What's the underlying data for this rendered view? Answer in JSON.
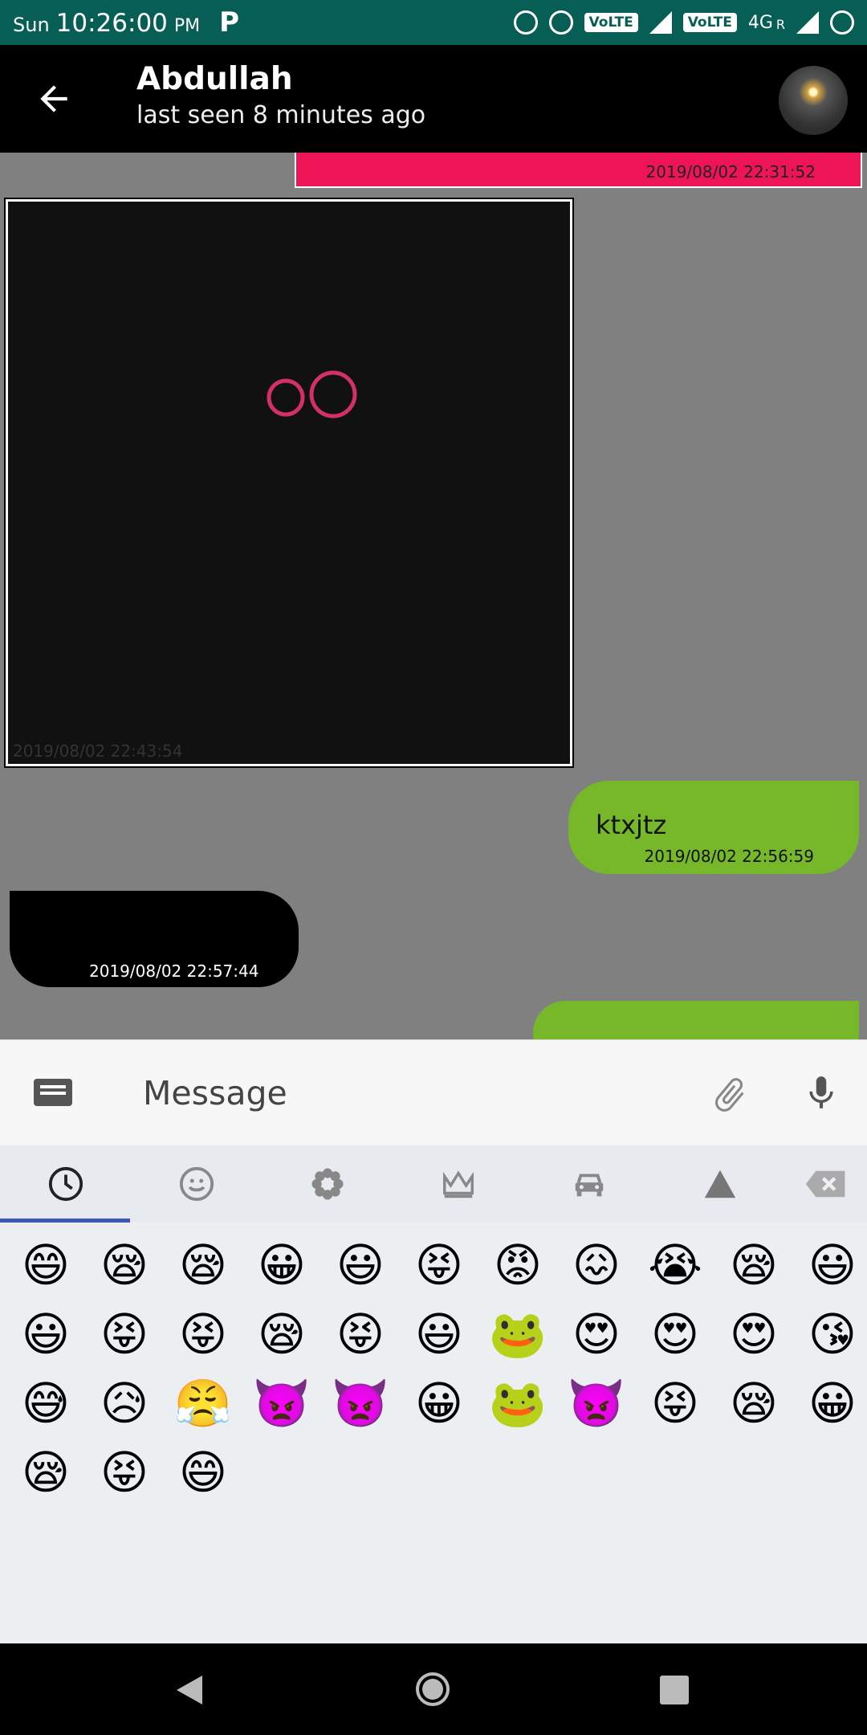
{
  "status_bar": {
    "day": "Sun",
    "time": "10:26:00",
    "ampm": "PM",
    "carrier_icon": "P",
    "volte1": "VoLTE",
    "volte2": "VoLTE",
    "network": "4G",
    "roaming": "R"
  },
  "header": {
    "contact_name": "Abdullah",
    "last_seen": "last seen 8 minutes ago"
  },
  "messages": [
    {
      "type": "outgoing-pink",
      "timestamp": "2019/08/02 22:31:52"
    },
    {
      "type": "incoming-image",
      "timestamp": "2019/08/02 22:43:54"
    },
    {
      "type": "outgoing",
      "text": "ktxjtz",
      "timestamp": "2019/08/02 22:56:59"
    },
    {
      "type": "incoming",
      "text": "😜😝😀😃😍😉",
      "timestamp": "2019/08/02 22:57:44"
    }
  ],
  "input": {
    "placeholder": "Message"
  },
  "emoji_tabs": [
    "recent",
    "smileys",
    "nature",
    "objects",
    "places",
    "symbols"
  ],
  "emoji_grid": [
    "😄",
    "😪",
    "😪",
    "😀",
    "😃",
    "😝",
    "😡",
    "😖",
    "😭",
    "😪",
    "😃",
    "😃",
    "😝",
    "😝",
    "😪",
    "😝",
    "😃",
    "🐸",
    "😍",
    "😍",
    "😍",
    "😘",
    "😅",
    "😥",
    "😤",
    "👿",
    "👿",
    "😀",
    "🐸",
    "👿",
    "😝",
    "😪",
    "😀",
    "😪",
    "😝",
    "😄"
  ],
  "colors": {
    "status_bar": "#075e54",
    "outgoing_bubble": "#76b82a",
    "pink_bubble": "#ee1458",
    "tab_indicator": "#3c5ab4"
  }
}
